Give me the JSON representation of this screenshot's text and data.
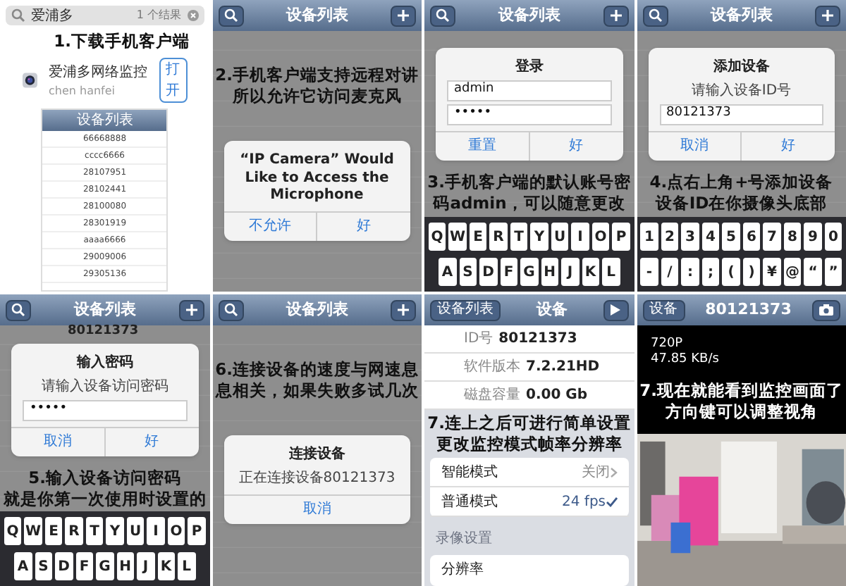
{
  "panels": [
    {
      "kind": "store",
      "search": {
        "value": "爱浦多",
        "count": "1 个结果"
      },
      "caption": [
        "1.下载手机客户端"
      ],
      "app": {
        "name": "爱浦多网络监控",
        "author": "chen hanfei",
        "button": "打开"
      },
      "preview": {
        "title": "设备列表",
        "rows": [
          "66668888",
          "cccc6666",
          "28107951",
          "28102441",
          "28100080",
          "28301919",
          "aaaa6666",
          "29009006",
          "29305136"
        ]
      }
    },
    {
      "kind": "prompt",
      "nav": {
        "kind": "list",
        "title": "设备列表"
      },
      "caption": [
        "2.手机客户端支持远程对讲",
        "所以允许它访问麦克风"
      ],
      "dialog": {
        "title": "“IP Camera” Would Like to Access the Microphone",
        "buttons": [
          "不允许",
          "好"
        ]
      }
    },
    {
      "kind": "form",
      "nav": {
        "kind": "list",
        "title": "设备列表"
      },
      "dialog": {
        "title": "登录",
        "fields": [
          "admin",
          "•••••"
        ],
        "buttons": [
          "重置",
          "好"
        ]
      },
      "caption": [
        "3.手机客户端的默认账号密",
        "码admin，可以随意更改"
      ],
      "keyboard": [
        [
          "Q",
          "W",
          "E",
          "R",
          "T",
          "Y",
          "U",
          "I",
          "O",
          "P"
        ],
        [
          "A",
          "S",
          "D",
          "F",
          "G",
          "H",
          "J",
          "K",
          "L"
        ]
      ]
    },
    {
      "kind": "form",
      "nav": {
        "kind": "list",
        "title": "设备列表"
      },
      "dialog": {
        "title": "添加设备",
        "message": "请输入设备ID号",
        "fields": [
          "80121373"
        ],
        "buttons": [
          "取消",
          "好"
        ]
      },
      "caption": [
        "4.点右上角+号添加设备",
        "设备ID在你摄像头底部"
      ],
      "keyboard": [
        [
          "1",
          "2",
          "3",
          "4",
          "5",
          "6",
          "7",
          "8",
          "9",
          "0"
        ],
        [
          "-",
          "/",
          ":",
          ";",
          "(",
          ")",
          "¥",
          "@",
          "“",
          "”"
        ]
      ]
    },
    {
      "kind": "form",
      "nav": {
        "kind": "list",
        "title": "设备列表"
      },
      "behind": "80121373",
      "dialog": {
        "title": "输入密码",
        "message": "请输入设备访问密码",
        "fields": [
          "•••••"
        ],
        "buttons": [
          "取消",
          "好"
        ]
      },
      "caption": [
        "5.输入设备访问密码",
        "就是你第一次使用时设置的"
      ],
      "keyboard": [
        [
          "Q",
          "W",
          "E",
          "R",
          "T",
          "Y",
          "U",
          "I",
          "O",
          "P"
        ],
        [
          "A",
          "S",
          "D",
          "F",
          "G",
          "H",
          "J",
          "K",
          "L"
        ]
      ]
    },
    {
      "kind": "prompt",
      "nav": {
        "kind": "list",
        "title": "设备列表"
      },
      "caption": [
        "6.连接设备的速度与网速息",
        "息相关，如果失败多试几次"
      ],
      "dialog": {
        "title": "连接设备",
        "message": "正在连接设备80121373",
        "buttons": [
          "取消"
        ]
      }
    },
    {
      "kind": "settings",
      "nav": {
        "kind": "detail",
        "back": "设备列表",
        "title": "设备"
      },
      "info": [
        {
          "label": "ID号",
          "value": "80121373"
        },
        {
          "label": "软件版本",
          "value": "7.2.21HD"
        },
        {
          "label": "磁盘容量",
          "value": "0.00 Gb"
        }
      ],
      "caption": [
        "7.连上之后可进行简单设置",
        "更改监控模式帧率分辨率"
      ],
      "modes": [
        {
          "label": "智能模式",
          "value": "关闭",
          "checked": false
        },
        {
          "label": "普通模式",
          "value": "24 fps",
          "checked": true
        }
      ],
      "section": "录像设置",
      "rows": [
        "分辨率"
      ]
    },
    {
      "kind": "video",
      "nav": {
        "kind": "video",
        "back": "设备",
        "title": "80121373"
      },
      "resolution": "720P",
      "rate": "47.85 KB/s",
      "caption": [
        "7.现在就能看到监控画面了",
        "方向键可以调整视角"
      ]
    }
  ]
}
